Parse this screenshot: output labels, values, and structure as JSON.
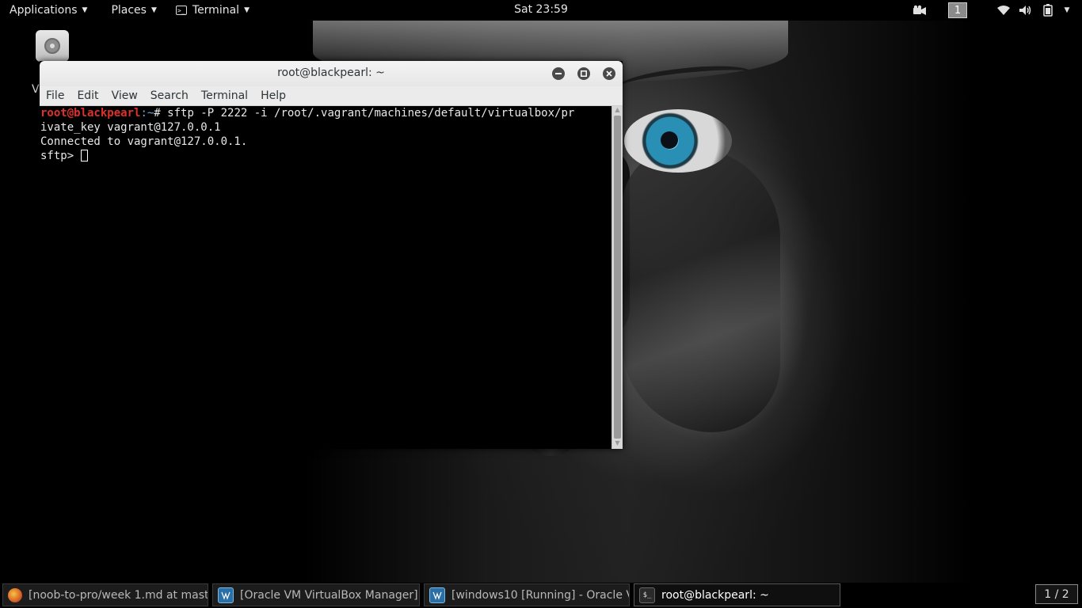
{
  "top_panel": {
    "applications_label": "Applications",
    "places_label": "Places",
    "terminal_label": "Terminal",
    "clock": "Sat 23:59",
    "workspace_number": "1"
  },
  "desktop": {
    "icon_label": "V"
  },
  "terminal_window": {
    "title": "root@blackpearl: ~",
    "menu": [
      "File",
      "Edit",
      "View",
      "Search",
      "Terminal",
      "Help"
    ],
    "prompt_user": "root@blackpearl",
    "prompt_path": ":~",
    "prompt_symbol": "# ",
    "command_line1": "sftp -P 2222 -i /root/.vagrant/machines/default/virtualbox/pr",
    "command_line2": "ivate_key vagrant@127.0.0.1",
    "output_line": "Connected to vagrant@127.0.0.1.",
    "sftp_prompt": "sftp> "
  },
  "taskbar": {
    "tasks": [
      {
        "label": "[noob-to-pro/week 1.md at maste…",
        "icon": "firefox-icon"
      },
      {
        "label": "[Oracle VM VirtualBox Manager]",
        "icon": "virtualbox-icon"
      },
      {
        "label": "[windows10 [Running] - Oracle V…",
        "icon": "virtualbox-icon"
      },
      {
        "label": "root@blackpearl: ~",
        "icon": "terminal-icon"
      }
    ],
    "pager": "1 / 2"
  },
  "colors": {
    "prompt_user": "#e0302c",
    "titlebar": "#eeeeee",
    "panel": "#000000"
  }
}
